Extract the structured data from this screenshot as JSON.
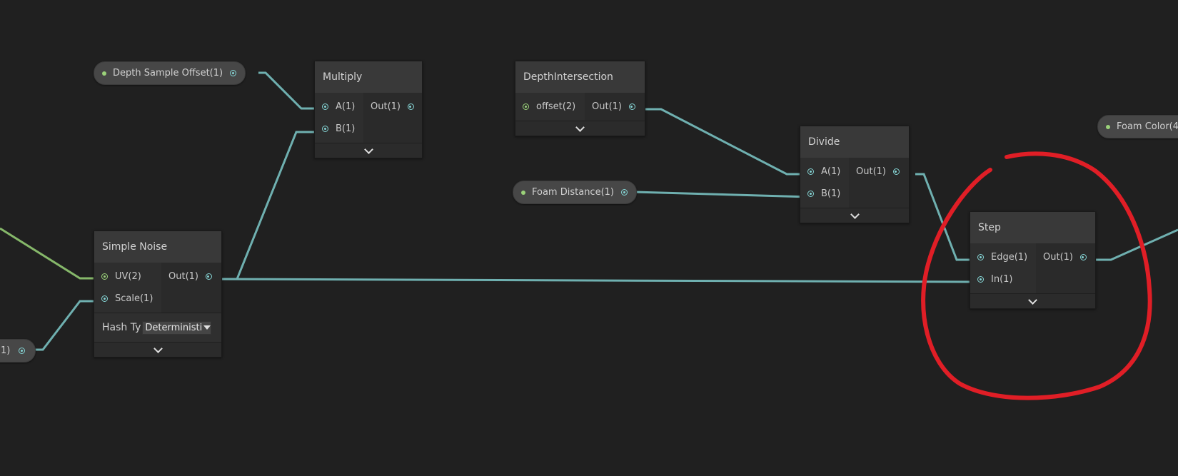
{
  "properties": {
    "depth_sample_offset": "Depth Sample Offset(1)",
    "foam_distance": "Foam Distance(1)",
    "foam_color": "Foam Color(4",
    "left_partial": "1)"
  },
  "nodes": {
    "multiply": {
      "title": "Multiply",
      "inputs": [
        "A(1)",
        "B(1)"
      ],
      "output": "Out(1)"
    },
    "depth_intersection": {
      "title": "DepthIntersection",
      "inputs": [
        "offset(2)"
      ],
      "output": "Out(1)"
    },
    "divide": {
      "title": "Divide",
      "inputs": [
        "A(1)",
        "B(1)"
      ],
      "output": "Out(1)"
    },
    "simple_noise": {
      "title": "Simple Noise",
      "inputs": [
        "UV(2)",
        "Scale(1)"
      ],
      "output": "Out(1)",
      "hash_label": "Hash Ty",
      "hash_value": "Deterministi"
    },
    "step": {
      "title": "Step",
      "inputs": [
        "Edge(1)",
        "In(1)"
      ],
      "output": "Out(1)"
    }
  },
  "colors": {
    "background": "#202020",
    "wire_float": "#6fb0b0",
    "wire_vector2": "#86b86a",
    "annotation": "#e01e26"
  },
  "annotation": {
    "shape": "hand-drawn-circle",
    "target": "step-node"
  }
}
